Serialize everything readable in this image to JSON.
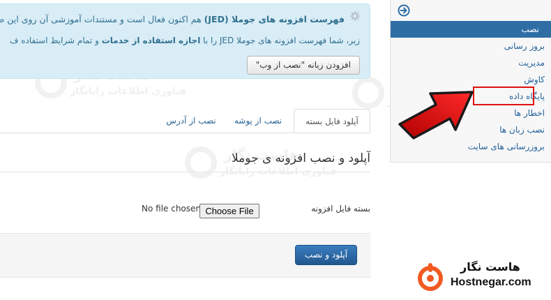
{
  "sidebar": {
    "toggle_icon": "circle-arrow-right-icon",
    "items": [
      {
        "label": "نصب",
        "active": true
      },
      {
        "label": "بروز رسانی",
        "active": false
      },
      {
        "label": "مدیریت",
        "active": false
      },
      {
        "label": "کاوش",
        "active": false
      },
      {
        "label": "پایگاه داده",
        "active": false
      },
      {
        "label": "اخطار ها",
        "active": false
      },
      {
        "label": "نصب زبان ها",
        "active": false
      },
      {
        "label": "بروزرسانی های سایت",
        "active": false
      }
    ],
    "highlight_color": "#e01010"
  },
  "notice": {
    "icon": "gear-icon",
    "title": "فهرست افزونه های جوملا (JED)",
    "title_rest": " هم اکنون فعال است و مستندات آموزشی آن روی این ص",
    "body_pre": "زیر، شما فهرست افزونه های جوملا JED را با ",
    "body_bold": "اجازه استفاده از خدمات",
    "body_post": " و تمام شرایط استفاده ف",
    "button_label": "افزودن زبانه \"نصب از وب\""
  },
  "tabs": [
    {
      "label": "آپلود فایل بسته",
      "active": true
    },
    {
      "label": "نصب از پوشه",
      "active": false
    },
    {
      "label": "نصب از آدرس",
      "active": false
    }
  ],
  "content": {
    "title": "آپلود و نصب افزونه ی جوملا",
    "field_label": "بسته فایل افزونه",
    "file_status": "No file chosen",
    "choose_button": "Choose File",
    "upload_button": "آپلود و نصب"
  },
  "watermark": {
    "name": "هاست نگار",
    "tagline": "فناوری اطلاعات رایانگار"
  },
  "brand": {
    "name_fa": "هاست نگار",
    "name_en": "Hostnegar.com",
    "logo_icon": "hostnegar-logo-icon",
    "accent": "#f15a22"
  },
  "colors": {
    "primary": "#2f6ea5",
    "notice_bg": "#d9edf7",
    "notice_text": "#31708f",
    "arrow": "#d81414"
  },
  "annotation": {
    "arrow_icon": "red-arrow-icon"
  }
}
